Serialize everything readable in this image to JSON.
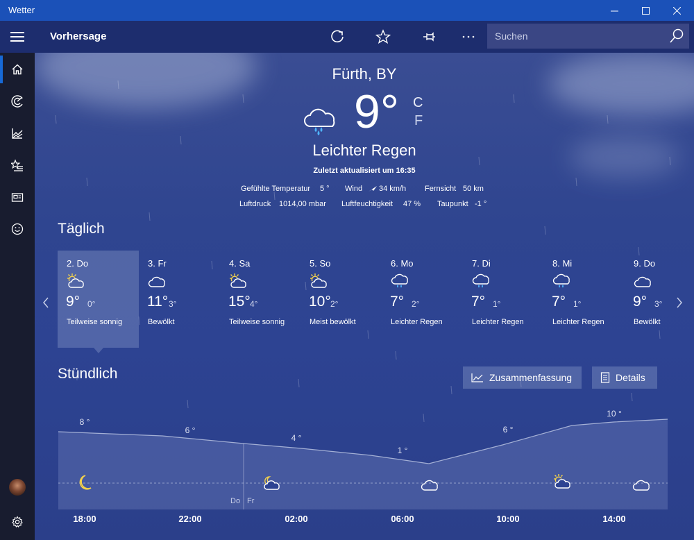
{
  "window": {
    "title": "Wetter"
  },
  "header": {
    "page_title": "Vorhersage",
    "search_placeholder": "Suchen"
  },
  "current": {
    "location": "Fürth, BY",
    "temperature": "9°",
    "unit_c": "C",
    "unit_f": "F",
    "condition": "Leichter Regen",
    "updated": "Zuletzt aktualisiert um 16:35",
    "details": {
      "feels_label": "Gefühlte Temperatur",
      "feels_value": "5 °",
      "wind_label": "Wind",
      "wind_value": "34 km/h",
      "visibility_label": "Fernsicht",
      "visibility_value": "50 km",
      "pressure_label": "Luftdruck",
      "pressure_value": "1014,00 mbar",
      "humidity_label": "Luftfeuchtigkeit",
      "humidity_value": "47 %",
      "dewpoint_label": "Taupunkt",
      "dewpoint_value": "-1 °"
    }
  },
  "daily": {
    "heading": "Täglich",
    "days": [
      {
        "name": "2. Do",
        "hi": "9°",
        "lo": "0°",
        "cond": "Teilweise sonnig",
        "icon": "partly-sunny-icon"
      },
      {
        "name": "3. Fr",
        "hi": "11°",
        "lo": "3°",
        "cond": "Bewölkt",
        "icon": "cloud-icon"
      },
      {
        "name": "4. Sa",
        "hi": "15°",
        "lo": "4°",
        "cond": "Teilweise sonnig",
        "icon": "partly-sunny-icon"
      },
      {
        "name": "5. So",
        "hi": "10°",
        "lo": "2°",
        "cond": "Meist bewölkt",
        "icon": "partly-sunny-icon"
      },
      {
        "name": "6. Mo",
        "hi": "7°",
        "lo": "2°",
        "cond": "Leichter Regen",
        "icon": "rain-cloud-icon"
      },
      {
        "name": "7. Di",
        "hi": "7°",
        "lo": "1°",
        "cond": "Leichter Regen",
        "icon": "rain-cloud-icon"
      },
      {
        "name": "8. Mi",
        "hi": "7°",
        "lo": "1°",
        "cond": "Leichter Regen",
        "icon": "rain-cloud-icon"
      },
      {
        "name": "9. Do",
        "hi": "9°",
        "lo": "3°",
        "cond": "Bewölkt",
        "icon": "cloud-icon"
      }
    ]
  },
  "hourly": {
    "heading": "Stündlich",
    "summary_label": "Zusammenfassung",
    "details_label": "Details",
    "times": [
      "18:00",
      "22:00",
      "02:00",
      "06:00",
      "10:00",
      "14:00"
    ],
    "temp_labels": [
      "8 °",
      "6 °",
      "4 °",
      "1 °",
      "6 °",
      "10 °"
    ],
    "day_before": "Do",
    "day_after": "Fr"
  },
  "colors": {
    "titlebar": "#1b51b8",
    "topbar": "#1d2d6e",
    "sidebar": "#181c2f",
    "accent": "#1769d6",
    "sun": "#f6d34a"
  }
}
